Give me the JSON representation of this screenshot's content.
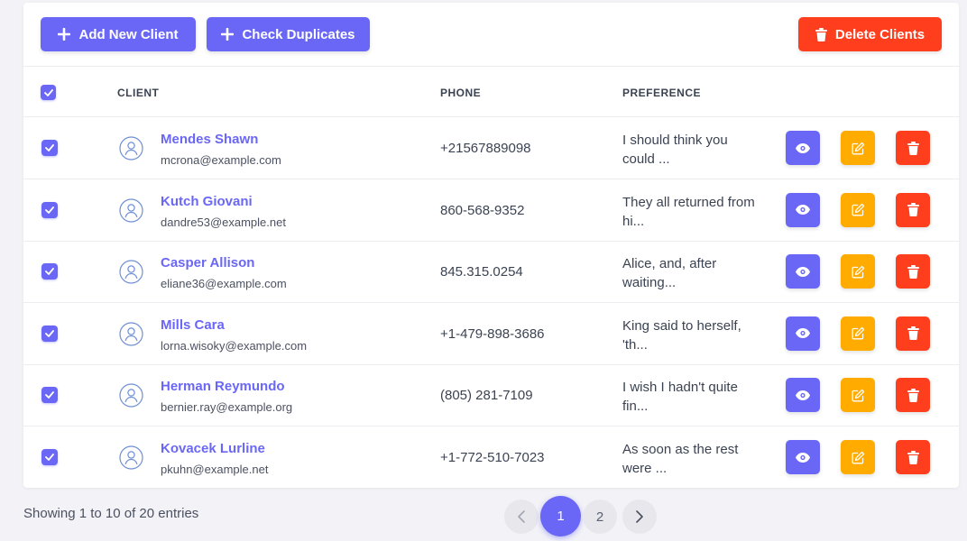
{
  "toolbar": {
    "add_label": "Add New Client",
    "duplicates_label": "Check Duplicates",
    "delete_label": "Delete Clients"
  },
  "table": {
    "columns": [
      "Client",
      "Phone",
      "Preference"
    ],
    "rows": [
      {
        "name": "Mendes Shawn",
        "email": "mcrona@example.com",
        "phone": "+21567889098",
        "preference": "I should think you could ..."
      },
      {
        "name": "Kutch Giovani",
        "email": "dandre53@example.net",
        "phone": "860-568-9352",
        "preference": "They all returned from hi..."
      },
      {
        "name": "Casper Allison",
        "email": "eliane36@example.com",
        "phone": "845.315.0254",
        "preference": "Alice, and, after waiting..."
      },
      {
        "name": "Mills Cara",
        "email": "lorna.wisoky@example.com",
        "phone": "+1-479-898-3686",
        "preference": "King said to herself, 'th..."
      },
      {
        "name": "Herman Reymundo",
        "email": "bernier.ray@example.org",
        "phone": "(805) 281-7109",
        "preference": "I wish I hadn't quite fin..."
      },
      {
        "name": "Kovacek Lurline",
        "email": "pkuhn@example.net",
        "phone": "+1-772-510-7023",
        "preference": "As soon as the rest were ..."
      }
    ]
  },
  "footer": {
    "info": "Showing 1 to 10 of 20 entries"
  },
  "pagination": {
    "pages": [
      "1",
      "2"
    ],
    "current": "1"
  },
  "colors": {
    "primary": "#6a67f6",
    "warning": "#ffab00",
    "danger": "#ff3e1d"
  },
  "icons": {
    "add": "plus-icon",
    "delete": "trash-icon",
    "view": "eye-icon",
    "edit": "edit-icon",
    "avatar": "user-icon",
    "prev": "chevron-left-icon",
    "next": "chevron-right-icon"
  }
}
